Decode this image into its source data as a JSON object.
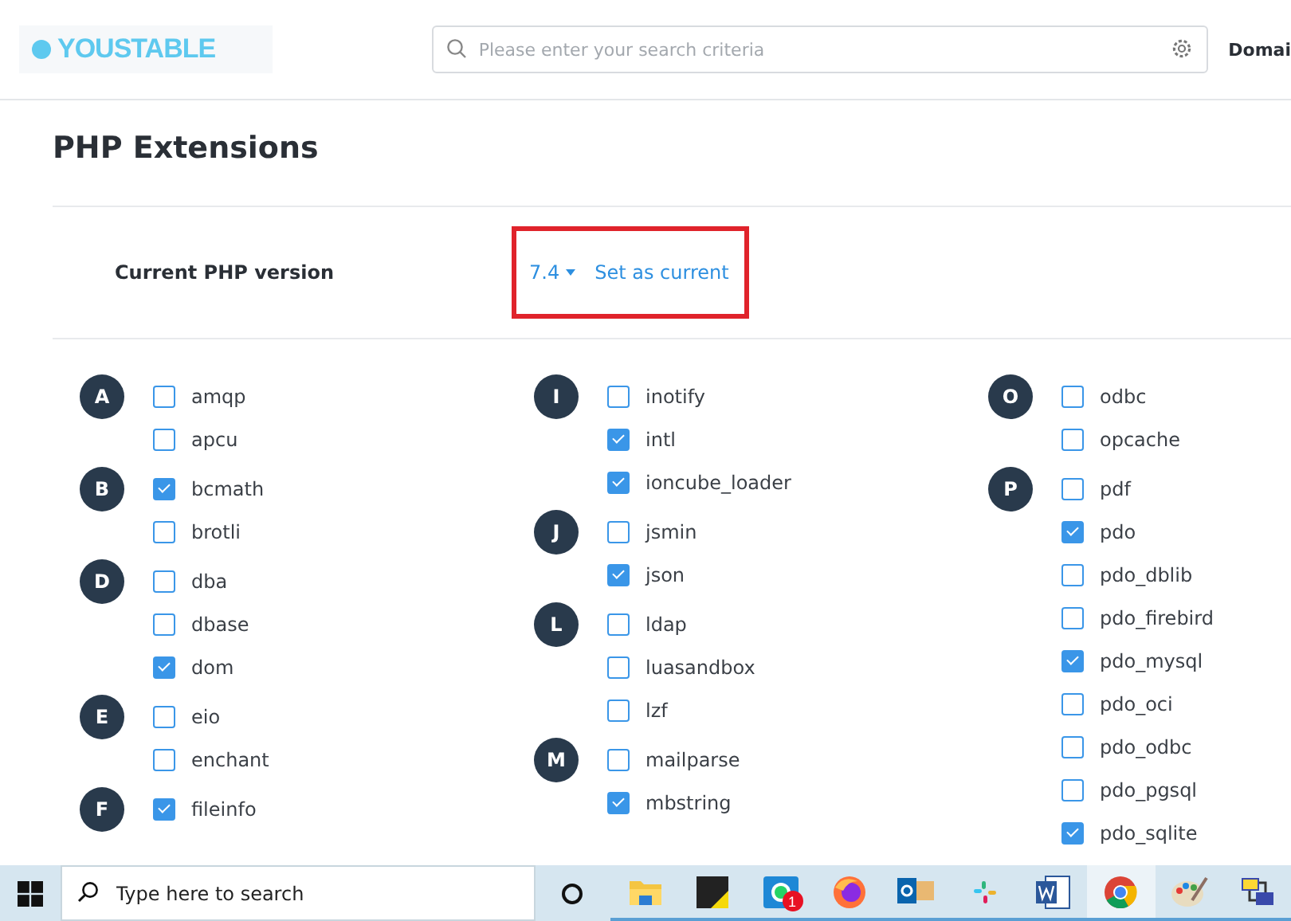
{
  "header": {
    "logo": "YOUSTABLE",
    "search": {
      "placeholder": "Please enter your search criteria"
    },
    "nav_item": "Domai"
  },
  "page": {
    "title": "PHP Extensions",
    "version_label": "Current PHP version",
    "version": "7.4",
    "set_current": "Set as current"
  },
  "columns": [
    {
      "groups": [
        {
          "letter": "A",
          "items": [
            {
              "name": "amqp",
              "checked": false
            },
            {
              "name": "apcu",
              "checked": false
            }
          ]
        },
        {
          "letter": "B",
          "items": [
            {
              "name": "bcmath",
              "checked": true
            },
            {
              "name": "brotli",
              "checked": false
            }
          ]
        },
        {
          "letter": "D",
          "items": [
            {
              "name": "dba",
              "checked": false
            },
            {
              "name": "dbase",
              "checked": false
            },
            {
              "name": "dom",
              "checked": true
            }
          ]
        },
        {
          "letter": "E",
          "items": [
            {
              "name": "eio",
              "checked": false
            },
            {
              "name": "enchant",
              "checked": false
            }
          ]
        },
        {
          "letter": "F",
          "items": [
            {
              "name": "fileinfo",
              "checked": true
            }
          ]
        }
      ]
    },
    {
      "groups": [
        {
          "letter": "I",
          "items": [
            {
              "name": "inotify",
              "checked": false
            },
            {
              "name": "intl",
              "checked": true
            },
            {
              "name": "ioncube_loader",
              "checked": true
            }
          ]
        },
        {
          "letter": "J",
          "items": [
            {
              "name": "jsmin",
              "checked": false
            },
            {
              "name": "json",
              "checked": true
            }
          ]
        },
        {
          "letter": "L",
          "items": [
            {
              "name": "ldap",
              "checked": false
            },
            {
              "name": "luasandbox",
              "checked": false
            },
            {
              "name": "lzf",
              "checked": false
            }
          ]
        },
        {
          "letter": "M",
          "items": [
            {
              "name": "mailparse",
              "checked": false
            },
            {
              "name": "mbstring",
              "checked": true
            }
          ]
        }
      ]
    },
    {
      "groups": [
        {
          "letter": "O",
          "items": [
            {
              "name": "odbc",
              "checked": false
            },
            {
              "name": "opcache",
              "checked": false
            }
          ]
        },
        {
          "letter": "P",
          "items": [
            {
              "name": "pdf",
              "checked": false
            },
            {
              "name": "pdo",
              "checked": true
            },
            {
              "name": "pdo_dblib",
              "checked": false
            },
            {
              "name": "pdo_firebird",
              "checked": false
            },
            {
              "name": "pdo_mysql",
              "checked": true
            },
            {
              "name": "pdo_oci",
              "checked": false
            },
            {
              "name": "pdo_odbc",
              "checked": false
            },
            {
              "name": "pdo_pgsql",
              "checked": false
            },
            {
              "name": "pdo_sqlite",
              "checked": true
            }
          ]
        }
      ]
    }
  ],
  "taskbar": {
    "search": {
      "placeholder": "Type here to search"
    },
    "apps": [
      {
        "kind": "folder",
        "selected": false
      },
      {
        "kind": "note",
        "selected": false
      },
      {
        "kind": "chat",
        "selected": false,
        "badge": "1"
      },
      {
        "kind": "fox",
        "selected": false
      },
      {
        "kind": "mail",
        "selected": false
      },
      {
        "kind": "hash",
        "selected": false
      },
      {
        "kind": "doc",
        "selected": false
      },
      {
        "kind": "chrome",
        "selected": true
      },
      {
        "kind": "palette",
        "selected": false
      },
      {
        "kind": "network",
        "selected": false
      }
    ]
  }
}
